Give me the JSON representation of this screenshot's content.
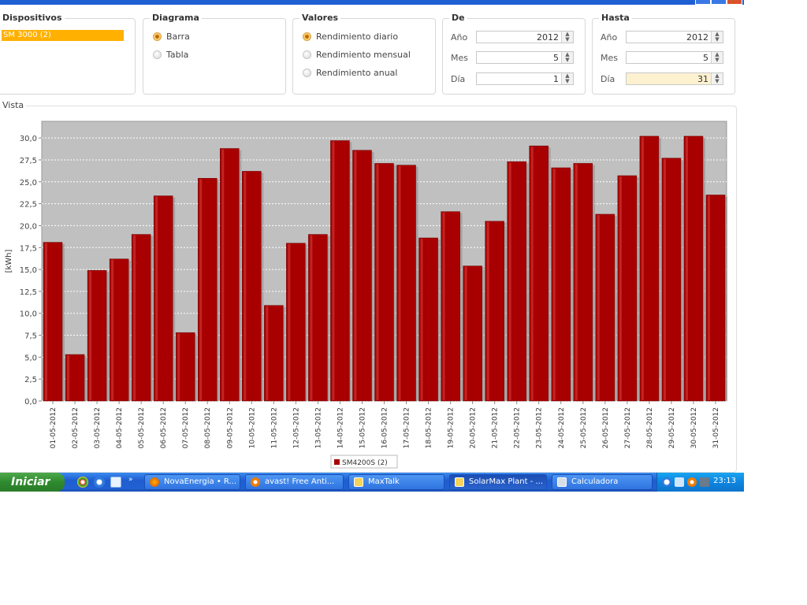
{
  "panels": {
    "dispositivos": {
      "title": "Dispositivos",
      "selected_device": "SM 3000 (2)"
    },
    "diagrama": {
      "title": "Diagrama",
      "options": [
        {
          "label": "Barra",
          "selected": true
        },
        {
          "label": "Tabla",
          "selected": false
        }
      ]
    },
    "valores": {
      "title": "Valores",
      "options": [
        {
          "label": "Rendimiento diario",
          "selected": true
        },
        {
          "label": "Rendimiento mensual",
          "selected": false
        },
        {
          "label": "Rendimiento anual",
          "selected": false
        }
      ]
    },
    "de": {
      "title": "De",
      "year_label": "Año",
      "year": "2012",
      "month_label": "Mes",
      "month": "5",
      "day_label": "Día",
      "day": "1"
    },
    "hasta": {
      "title": "Hasta",
      "year_label": "Año",
      "year": "2012",
      "month_label": "Mes",
      "month": "5",
      "day_label": "Día",
      "day": "31"
    },
    "vista": {
      "title": "Vista"
    }
  },
  "chart_data": {
    "type": "bar",
    "ylabel": "[kWh]",
    "ylim": [
      0,
      30
    ],
    "yticks": [
      "0,0",
      "2,5",
      "5,0",
      "7,5",
      "10,0",
      "12,5",
      "15,0",
      "17,5",
      "20,0",
      "22,5",
      "25,0",
      "27,5",
      "30,0"
    ],
    "categories": [
      "01-05-2012",
      "02-05-2012",
      "03-05-2012",
      "04-05-2012",
      "05-05-2012",
      "06-05-2012",
      "07-05-2012",
      "08-05-2012",
      "09-05-2012",
      "10-05-2012",
      "11-05-2012",
      "12-05-2012",
      "13-05-2012",
      "14-05-2012",
      "15-05-2012",
      "16-05-2012",
      "17-05-2012",
      "18-05-2012",
      "19-05-2012",
      "20-05-2012",
      "21-05-2012",
      "22-05-2012",
      "23-05-2012",
      "24-05-2012",
      "25-05-2012",
      "26-05-2012",
      "27-05-2012",
      "28-05-2012",
      "29-05-2012",
      "30-05-2012",
      "31-05-2012"
    ],
    "series": [
      {
        "name": "SM4200S (2)",
        "values": [
          18.1,
          5.3,
          14.9,
          16.2,
          19.0,
          23.4,
          7.8,
          25.4,
          28.8,
          26.2,
          10.9,
          18.0,
          19.0,
          29.7,
          28.6,
          27.1,
          26.9,
          18.6,
          21.6,
          15.4,
          20.5,
          27.3,
          29.1,
          26.6,
          27.1,
          21.3,
          25.7,
          30.2,
          27.7,
          30.2,
          23.5
        ]
      }
    ],
    "grid": true,
    "legend": "bottom-center",
    "bar_color": "#a80000",
    "plot_background": "#c0c0c0"
  },
  "taskbar": {
    "start_label": "Iniciar",
    "tasks": [
      {
        "label": "NovaEnergia • R..."
      },
      {
        "label": "avast! Free Anti..."
      },
      {
        "label": "MaxTalk"
      },
      {
        "label": "SolarMax Plant - ..."
      },
      {
        "label": "Calculadora"
      }
    ],
    "clock": "23:13"
  },
  "colors": {
    "taskbar_blue": "#2160d2",
    "start_green": "#2f8a2e",
    "selection": "#ffb000"
  }
}
